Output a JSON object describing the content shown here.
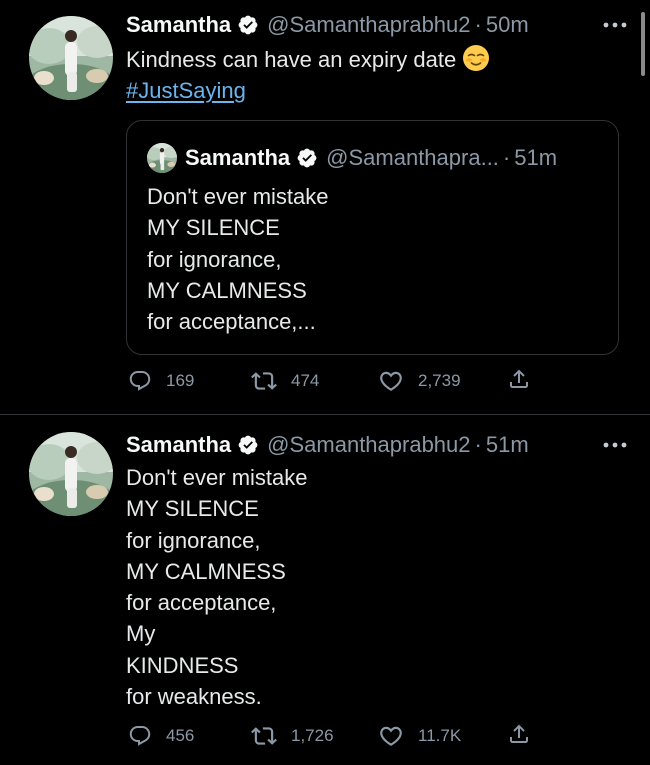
{
  "tweets": [
    {
      "author": {
        "name": "Samantha",
        "handle": "@Samanthaprabhu2"
      },
      "time": "50m",
      "text": "Kindness can have an expiry date",
      "emoji": "relieved-smiling-face",
      "hashtag": "#JustSaying",
      "quoted": {
        "author": {
          "name": "Samantha",
          "handle": "@Samanthapra..."
        },
        "time": "51m",
        "text": "Don't ever mistake\nMY SILENCE\nfor ignorance,\nMY CALMNESS\nfor acceptance,..."
      },
      "stats": {
        "replies": "169",
        "retweets": "474",
        "likes": "2,739"
      }
    },
    {
      "author": {
        "name": "Samantha",
        "handle": "@Samanthaprabhu2"
      },
      "time": "51m",
      "text": "Don't ever mistake\nMY SILENCE\nfor ignorance,\nMY CALMNESS\nfor acceptance,\nMy\nKINDNESS\nfor weakness.",
      "stats": {
        "replies": "456",
        "retweets": "1,726",
        "likes": "11.7K"
      }
    }
  ],
  "separator": "·",
  "icons": [
    "verified-badge-icon",
    "more-options-icon",
    "reply-icon",
    "retweet-icon",
    "like-icon",
    "share-icon"
  ],
  "colors": {
    "background": "#000000",
    "text": "#e7e9ea",
    "secondary": "#8b98a5",
    "link": "#6cb4ee",
    "border": "#2f3336"
  }
}
